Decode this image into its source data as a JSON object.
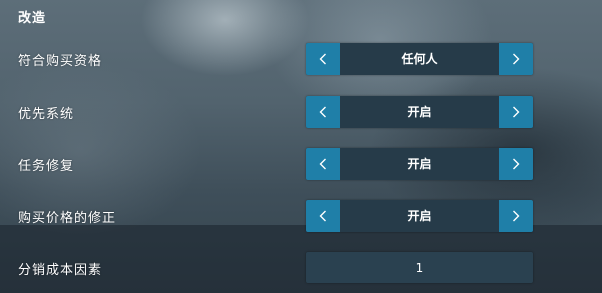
{
  "section": {
    "title": "改造"
  },
  "settings": [
    {
      "label": "符合购买资格",
      "value": "任何人"
    },
    {
      "label": "优先系统",
      "value": "开启"
    },
    {
      "label": "任务修复",
      "value": "开启"
    },
    {
      "label": "购买价格的修正",
      "value": "开启"
    },
    {
      "label": "分销成本因素",
      "value": "1"
    }
  ],
  "icons": {
    "prev": "chevron-left-icon",
    "next": "chevron-right-icon"
  },
  "colors": {
    "accent": "#1f7fa8",
    "selector_bg": "#263b49",
    "text": "#ffffff"
  }
}
